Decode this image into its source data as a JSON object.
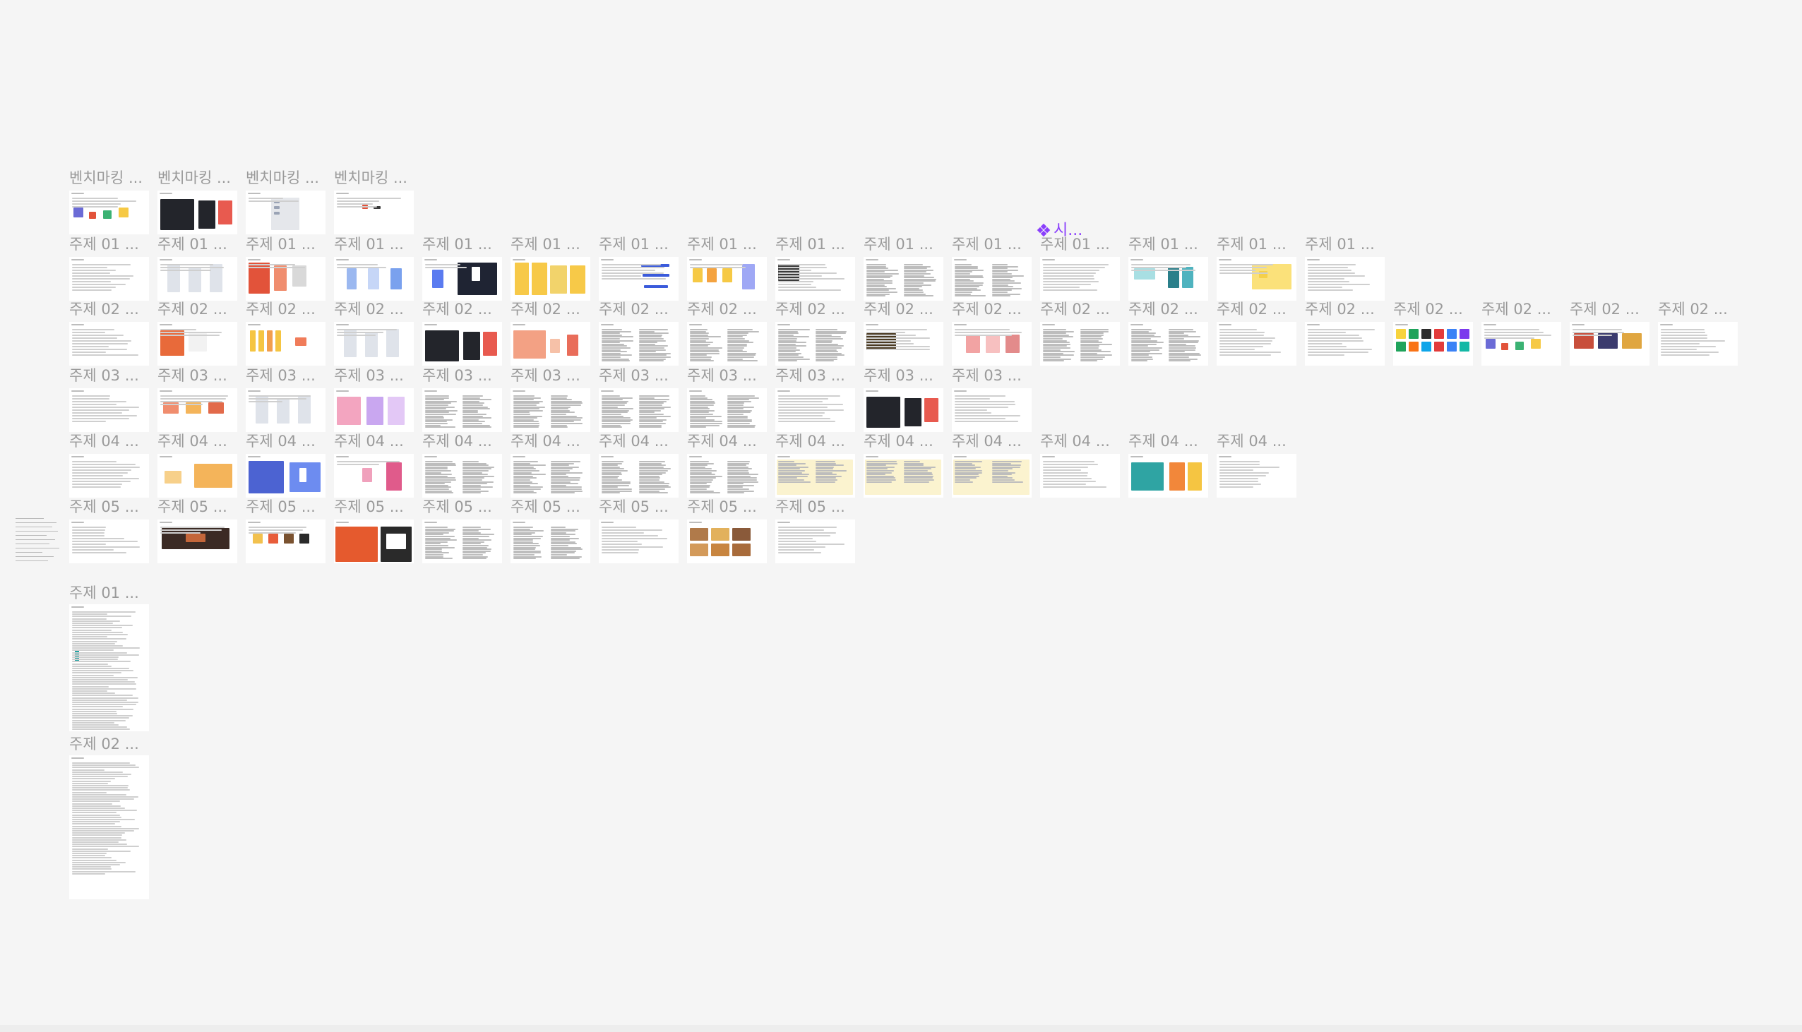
{
  "canvas": {
    "background_color": "#f5f5f5",
    "label_color": "#9a9a9a",
    "frame_color": "#ffffff"
  },
  "component_label": {
    "icon": "component-diamond-icon",
    "text": "시...",
    "color": "#8a3ffc"
  },
  "rows": [
    {
      "labels": [
        "벤치마킹 ...",
        "벤치마킹 ...",
        "벤치마킹 ...",
        "벤치마킹 ..."
      ],
      "thumbs": [
        "mixed-colorful",
        "dark-ui",
        "list-ui",
        "sparse-doc"
      ]
    },
    {
      "labels": [
        "주제 01 ...",
        "주제 01 ...",
        "주제 01 ...",
        "주제 01 ...",
        "주제 01 ...",
        "주제 01 ...",
        "주제 01 ...",
        "주제 01 ...",
        "주제 01 ...",
        "주제 01 ...",
        "주제 01 ...",
        "주제 01 ...",
        "주제 01 ...",
        "주제 01 ...",
        "주제 01 ..."
      ],
      "thumbs": [
        "text-doc",
        "phone-mockups",
        "orange-red-ui",
        "phone-blue",
        "dark-blue-ui",
        "yellow-ui",
        "blue-lines",
        "yellow-illustration",
        "photo-doc",
        "dense-text",
        "dense-text",
        "text-doc",
        "teal-ui",
        "yellow-cards",
        "text-doc"
      ]
    },
    {
      "labels": [
        "주제 02 ...",
        "주제 02 ...",
        "주제 02 ...",
        "주제 02 ...",
        "주제 02 ...",
        "주제 02 ...",
        "주제 02 ...",
        "주제 02 ...",
        "주제 02 ...",
        "주제 02 ...",
        "주제 02 ...",
        "주제 02 ...",
        "주제 02 ...",
        "주제 02 ...",
        "주제 02 ...",
        "주제 02 ...",
        "주제 02 ...",
        "주제 02 ...",
        "주제 02 ..."
      ],
      "thumbs": [
        "text-doc",
        "orange-ui",
        "yellow-grid",
        "phone-mockups",
        "dark-ui",
        "gradient-orange",
        "dense-text",
        "dense-text",
        "dense-text",
        "photo-dark",
        "pink-cards",
        "dense-text",
        "dense-text",
        "text-doc",
        "text-doc",
        "app-icons",
        "mixed-colorful",
        "photo-cards",
        "text-doc"
      ]
    },
    {
      "labels": [
        "주제 03 ...",
        "주제 03 ...",
        "주제 03 ...",
        "주제 03 ...",
        "주제 03 ...",
        "주제 03 ...",
        "주제 03 ...",
        "주제 03 ...",
        "주제 03 ...",
        "주제 03 ...",
        "주제 03 ..."
      ],
      "thumbs": [
        "text-doc",
        "orange-cards",
        "phone-mockups",
        "pink-purple-ui",
        "dense-text",
        "dense-text",
        "dense-text",
        "dense-text",
        "text-doc",
        "dark-ui",
        "text-doc"
      ]
    },
    {
      "labels": [
        "주제 04 ...",
        "주제 04 ...",
        "주제 04 ...",
        "주제 04 ...",
        "주제 04 ...",
        "주제 04 ...",
        "주제 04 ...",
        "주제 04 ...",
        "주제 04 ...",
        "주제 04 ...",
        "주제 04 ...",
        "주제 04 ...",
        "주제 04 ...",
        "주제 04 ..."
      ],
      "thumbs": [
        "text-doc",
        "orange-yellow-ui",
        "blue-ui",
        "pink-ui",
        "dense-text",
        "dense-text",
        "dense-text",
        "dense-text",
        "yellow-doc",
        "yellow-doc",
        "yellow-doc",
        "text-doc",
        "teal-orange-ui",
        "text-doc"
      ]
    },
    {
      "labels": [
        "주제 05 ...",
        "주제 05 ...",
        "주제 05 ...",
        "주제 05 ...",
        "주제 05 ...",
        "주제 05 ...",
        "주제 05 ...",
        "주제 05 ...",
        "주제 05 ..."
      ],
      "thumbs": [
        "text-doc",
        "dark-brown-ui",
        "food-icons",
        "orange-dark-ui",
        "dense-text",
        "dense-text",
        "text-doc",
        "photo-food",
        "text-doc"
      ]
    }
  ],
  "tall_frames": [
    {
      "label": "주제 01 ...",
      "thumb": "long-doc-teal"
    },
    {
      "label": "주제 02 ...",
      "thumb": "long-doc"
    }
  ]
}
